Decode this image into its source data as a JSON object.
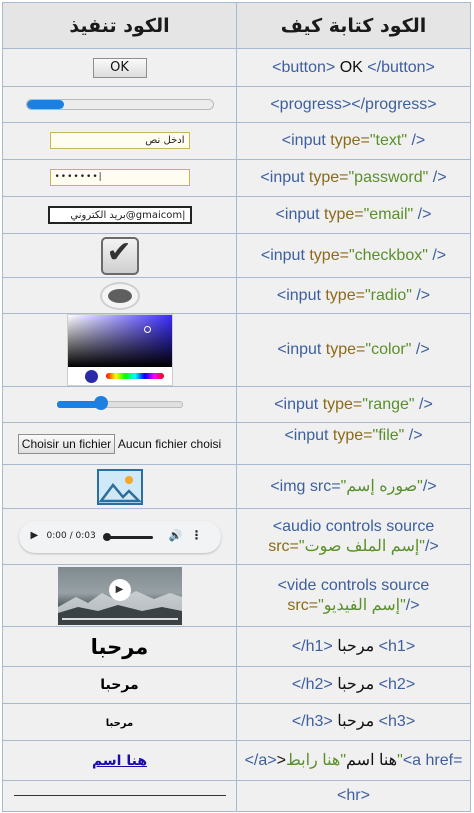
{
  "header": {
    "output_label": "الكود تنفيذ",
    "code_label": "الكود كتابة كيف"
  },
  "rows": {
    "button": {
      "code_open": "<button>",
      "code_text": " OK ",
      "code_close": "</button>",
      "output_label": "OK"
    },
    "progress": {
      "code": "<progress></progress>",
      "value_fraction": 0.2
    },
    "text": {
      "open": "<input ",
      "attr": "type=",
      "value": "\"text\"",
      "close": " />",
      "output_value": "ادخل نص"
    },
    "password": {
      "open": "<input ",
      "attr": "type=",
      "value": "\"password\"",
      "close": " />",
      "output_value": "•••••••|"
    },
    "email": {
      "open": "<input ",
      "attr": "type=",
      "value": "\"email\"",
      "close": " />",
      "output_value": "بريد الكتروني@gmaicom|"
    },
    "checkbox": {
      "open": "<input ",
      "attr": "type=",
      "value": "\"checkbox\"",
      "close": " />",
      "checked": true,
      "check_glyph": "✔"
    },
    "radio": {
      "open": "<input ",
      "attr": "type=",
      "value": "\"radio\"",
      "close": " />"
    },
    "color": {
      "open": "<input ",
      "attr": "type=",
      "value": "\"color\"",
      "close": " />",
      "selected_color": "#2a2aa8"
    },
    "range": {
      "open": "<input ",
      "attr": "type=",
      "value": "\"range\"",
      "close": " />",
      "value_fraction": 0.35
    },
    "file": {
      "open": "<input ",
      "attr": "type=",
      "value": "\"file\"",
      "close": " />",
      "button_label": "Choisir un fichier",
      "status": "Aucun fichier choisi"
    },
    "img": {
      "open": "<img src=",
      "value": "\"صوره إسم\"",
      "close": "/>"
    },
    "audio": {
      "line1": "<audio controls source",
      "line2_attr": "src=",
      "line2_value": "\"إسم الملف صوت\"",
      "line2_close": "/>",
      "time": "0:00 / 0:03",
      "play_glyph": "▶",
      "volume_glyph": "🔊",
      "more_glyph": "⋮"
    },
    "video": {
      "line1": "<vide controls source",
      "line2_attr": "src=",
      "line2_value": "\"إسم الفيديو\"",
      "line2_close": "/>",
      "play_glyph": "▶"
    },
    "h1": {
      "open": "<h1>",
      "text": " مرحبا ",
      "close": "</h1>",
      "output": "مرحبا"
    },
    "h2": {
      "open": "<h2>",
      "text": " مرحبا ",
      "close": "</h2>",
      "output": "مرحبا"
    },
    "h3": {
      "open": "<h3>",
      "text": " مرحبا ",
      "close": "</h3>",
      "output": "مرحبا"
    },
    "link": {
      "open": "<a href=",
      "value": "\"هنا رابط\"",
      "text": ">هنا اسم",
      "close": "</a>",
      "output": "هنا اسم"
    },
    "hr": {
      "code": "<hr>"
    }
  },
  "colors": {
    "tag": "#3e5f9e",
    "keyword": "#8b6a1a",
    "string": "#5a8f2b",
    "accent": "#1d7fe0",
    "cell_bg": "#f0f0f0",
    "border": "#a9b9cf"
  }
}
